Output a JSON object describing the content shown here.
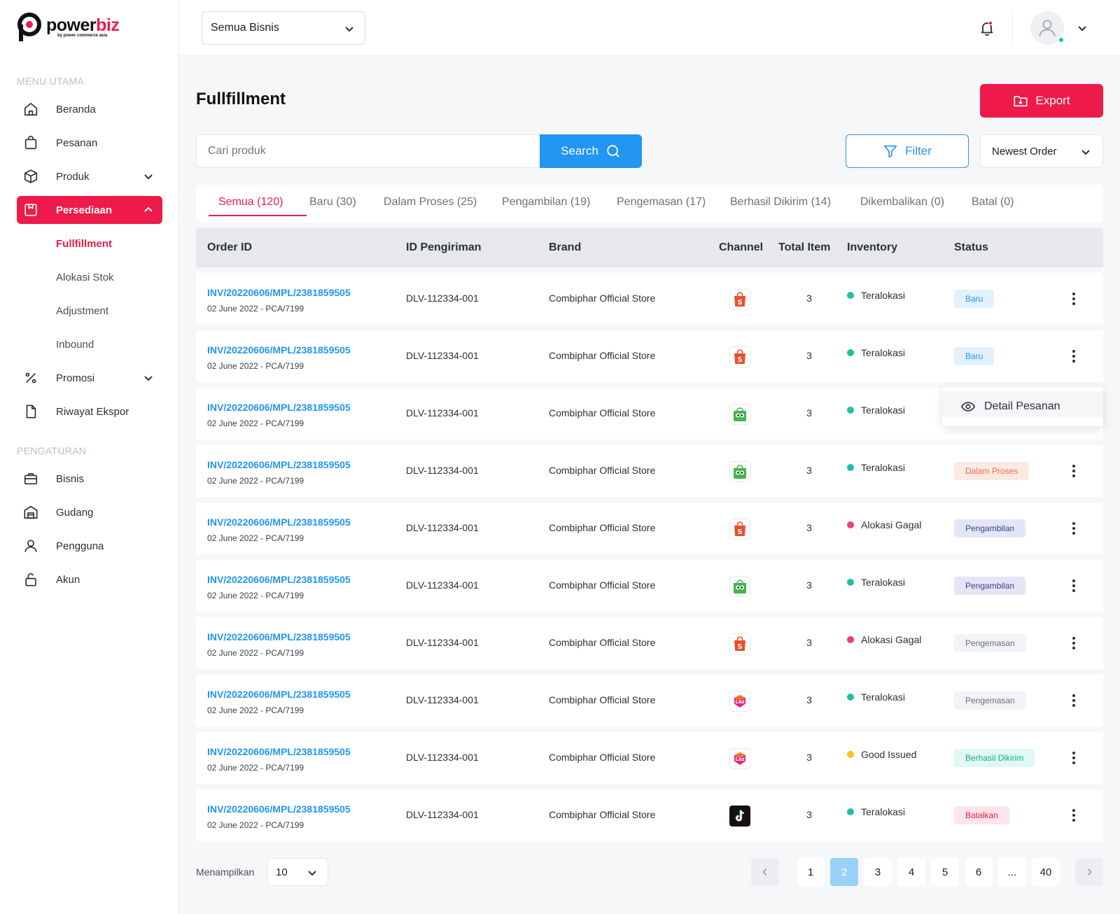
{
  "brand": {
    "word_a": "power",
    "word_b": "biz",
    "sub": "by power commerce asia"
  },
  "colors": {
    "primary": "#ee1b4a",
    "blue": "#2196f3"
  },
  "sidebar": {
    "section_main": "MENU UTAMA",
    "section_settings": "PENGATURAN",
    "items": [
      {
        "label": "Beranda",
        "icon": "home-icon"
      },
      {
        "label": "Pesanan",
        "icon": "shopping-bag-icon"
      },
      {
        "label": "Produk",
        "icon": "box-icon"
      },
      {
        "label": "Persediaan",
        "icon": "inventory-icon"
      },
      {
        "label": "Promosi",
        "icon": "percent-icon"
      },
      {
        "label": "Riwayat Ekspor",
        "icon": "file-icon"
      }
    ],
    "sub_items": [
      "Fullfillment",
      "Alokasi Stok",
      "Adjustment",
      "Inbound"
    ],
    "settings_items": [
      {
        "label": "Bisnis",
        "icon": "briefcase-icon"
      },
      {
        "label": "Gudang",
        "icon": "warehouse-icon"
      },
      {
        "label": "Pengguna",
        "icon": "user-icon"
      },
      {
        "label": "Akun",
        "icon": "lock-icon"
      }
    ]
  },
  "topbar": {
    "business_select": "Semua Bisnis"
  },
  "main": {
    "title": "Fullfillment",
    "export_label": "Export",
    "search_placeholder": "Cari produk",
    "search_label": "Search",
    "filter_label": "Filter",
    "sort_value": "Newest Order",
    "tabs": [
      "Semua (120)",
      "Baru (30)",
      "Dalam Proses (25)",
      "Pengambilan (19)",
      "Pengemasan (17)",
      "Berhasil Dikirim (14)",
      "Dikembalikan (0)",
      "Batal (0)"
    ],
    "columns": [
      "Order ID",
      "ID Pengiriman",
      "Brand",
      "Channel",
      "Total Item",
      "Inventory",
      "Status"
    ],
    "rows": [
      {
        "order_id": "INV/20220606/MPL/2381859505",
        "sub": "02 June 2022 - PCA/7199",
        "ship_id": "DLV-112334-001",
        "brand": "Combiphar Official Store",
        "channel": "shopee",
        "total": "3",
        "inventory": "Teralokasi",
        "status": "Baru"
      },
      {
        "order_id": "INV/20220606/MPL/2381859505",
        "sub": "02 June 2022 - PCA/7199",
        "ship_id": "DLV-112334-001",
        "brand": "Combiphar Official Store",
        "channel": "shopee",
        "total": "3",
        "inventory": "Teralokasi",
        "status": "Baru"
      },
      {
        "order_id": "INV/20220606/MPL/2381859505",
        "sub": "02 June 2022 - PCA/7199",
        "ship_id": "DLV-112334-001",
        "brand": "Combiphar Official Store",
        "channel": "tokopedia",
        "total": "3",
        "inventory": "Teralokasi",
        "status": ""
      },
      {
        "order_id": "INV/20220606/MPL/2381859505",
        "sub": "02 June 2022 - PCA/7199",
        "ship_id": "DLV-112334-001",
        "brand": "Combiphar Official Store",
        "channel": "tokopedia",
        "total": "3",
        "inventory": "Teralokasi",
        "status": "Dalam Proses"
      },
      {
        "order_id": "INV/20220606/MPL/2381859505",
        "sub": "02 June 2022 - PCA/7199",
        "ship_id": "DLV-112334-001",
        "brand": "Combiphar Official Store",
        "channel": "shopee",
        "total": "3",
        "inventory": "Alokasi Gagal",
        "status": "Pengambilan"
      },
      {
        "order_id": "INV/20220606/MPL/2381859505",
        "sub": "02 June 2022 - PCA/7199",
        "ship_id": "DLV-112334-001",
        "brand": "Combiphar Official Store",
        "channel": "tokopedia",
        "total": "3",
        "inventory": "Teralokasi",
        "status": "Pengambilan"
      },
      {
        "order_id": "INV/20220606/MPL/2381859505",
        "sub": "02 June 2022 - PCA/7199",
        "ship_id": "DLV-112334-001",
        "brand": "Combiphar Official Store",
        "channel": "shopee",
        "total": "3",
        "inventory": "Alokasi Gagal",
        "status": "Pengemasan"
      },
      {
        "order_id": "INV/20220606/MPL/2381859505",
        "sub": "02 June 2022 - PCA/7199",
        "ship_id": "DLV-112334-001",
        "brand": "Combiphar Official Store",
        "channel": "lazada",
        "total": "3",
        "inventory": "Teralokasi",
        "status": "Pengemasan"
      },
      {
        "order_id": "INV/20220606/MPL/2381859505",
        "sub": "02 June 2022 - PCA/7199",
        "ship_id": "DLV-112334-001",
        "brand": "Combiphar Official Store",
        "channel": "lazada",
        "total": "3",
        "inventory": "Good Issued",
        "status": "Berhasil Dikirim"
      },
      {
        "order_id": "INV/20220606/MPL/2381859505",
        "sub": "02 June 2022 - PCA/7199",
        "ship_id": "DLV-112334-001",
        "brand": "Combiphar Official Store",
        "channel": "tiktok",
        "total": "3",
        "inventory": "Teralokasi",
        "status": "Batalkan"
      }
    ],
    "inventory_colors": {
      "Teralokasi": "#1cc2a2",
      "Alokasi Gagal": "#ee3f6a",
      "Good Issued": "#f5c518"
    },
    "status_styles": {
      "Baru": {
        "bg": "#e1f1fd",
        "fg": "#2196f3"
      },
      "Dalam Proses": {
        "bg": "#fde9e4",
        "fg": "#f26a4b"
      },
      "Pengambilan": {
        "bg": "#e4e6f6",
        "fg": "#3a3f8f"
      },
      "Pengemasan": {
        "bg": "#f2f3f5",
        "fg": "#6b7079"
      },
      "Berhasil Dikirim": {
        "bg": "#e0f7f4",
        "fg": "#1aa891"
      },
      "Batalkan": {
        "bg": "#fde5ea",
        "fg": "#ee1b4a"
      }
    },
    "popup_label": "Detail Pesanan"
  },
  "footer": {
    "showing_label": "Menampilkan",
    "per_page": "10",
    "pages": [
      "1",
      "2",
      "3",
      "4",
      "5",
      "6",
      "...",
      "40"
    ],
    "current_page": "2"
  }
}
